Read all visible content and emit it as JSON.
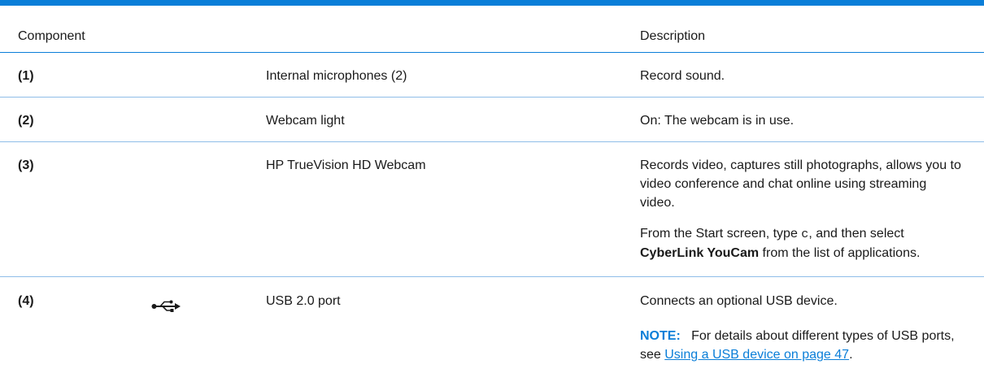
{
  "table": {
    "headers": {
      "component": "Component",
      "description": "Description"
    },
    "rows": [
      {
        "number": "(1)",
        "name": "Internal microphones (2)",
        "description": "Record sound."
      },
      {
        "number": "(2)",
        "name": "Webcam light",
        "description": "On: The webcam is in use."
      },
      {
        "number": "(3)",
        "name": "HP TrueVision HD Webcam",
        "description": "Records video, captures still photographs, allows you to video conference and chat online using streaming video.",
        "extra": {
          "before": "From the Start screen, type ",
          "code": "c",
          "middle": ", and then select ",
          "bold": "CyberLink YouCam",
          "after": " from the list of applications."
        }
      },
      {
        "number": "(4)",
        "icon": "usb-icon",
        "name": "USB 2.0 port",
        "description": "Connects an optional USB device.",
        "note": {
          "label": "NOTE:",
          "text": "For details about different types of USB ports, see ",
          "link": "Using a USB device on page 47",
          "end": "."
        }
      }
    ]
  },
  "colors": {
    "accent": "#0a7ed8",
    "row_divider": "#8fbde8"
  }
}
